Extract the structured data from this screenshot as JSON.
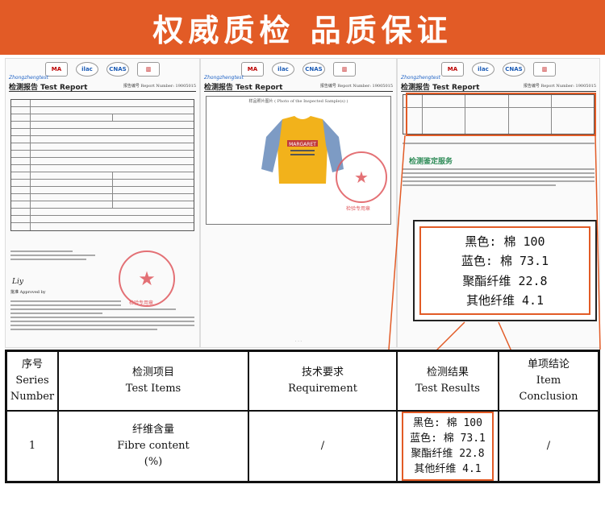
{
  "banner": {
    "title": "权威质检 品质保证"
  },
  "doc": {
    "brand": "Zhongzhengtest",
    "report_title": "检测报告 Test Report",
    "report_no": "报告编号 Report Number: 19005015",
    "sample_caption": "样品照片图片 ( Photo of the Inspected Sample(s) )",
    "approval": "批准 Approved by",
    "stamp_text": "检验专用章",
    "green_title": "检测鉴定服务"
  },
  "callout": {
    "lines": [
      "黑色: 棉 100",
      "蓝色: 棉 73.1",
      "聚酯纤维 22.8",
      "其他纤维 4.1"
    ]
  },
  "table": {
    "headers": {
      "series": [
        "序号",
        "Series",
        "Number"
      ],
      "items": [
        "检测项目",
        "Test Items"
      ],
      "requirement": [
        "技术要求",
        "Requirement"
      ],
      "results": [
        "检测结果",
        "Test Results"
      ],
      "conclusion": [
        "单项结论",
        "Item",
        "Conclusion"
      ]
    },
    "row": {
      "series": "1",
      "items": [
        "纤维含量",
        "Fibre content",
        "(%)"
      ],
      "requirement": "/",
      "results": [
        "黑色: 棉 100",
        "蓝色: 棉 73.1",
        "聚酯纤维 22.8",
        "其他纤维 4.1"
      ],
      "conclusion": "/"
    }
  },
  "colors": {
    "accent": "#e25b26",
    "stamp": "#e0595e"
  }
}
